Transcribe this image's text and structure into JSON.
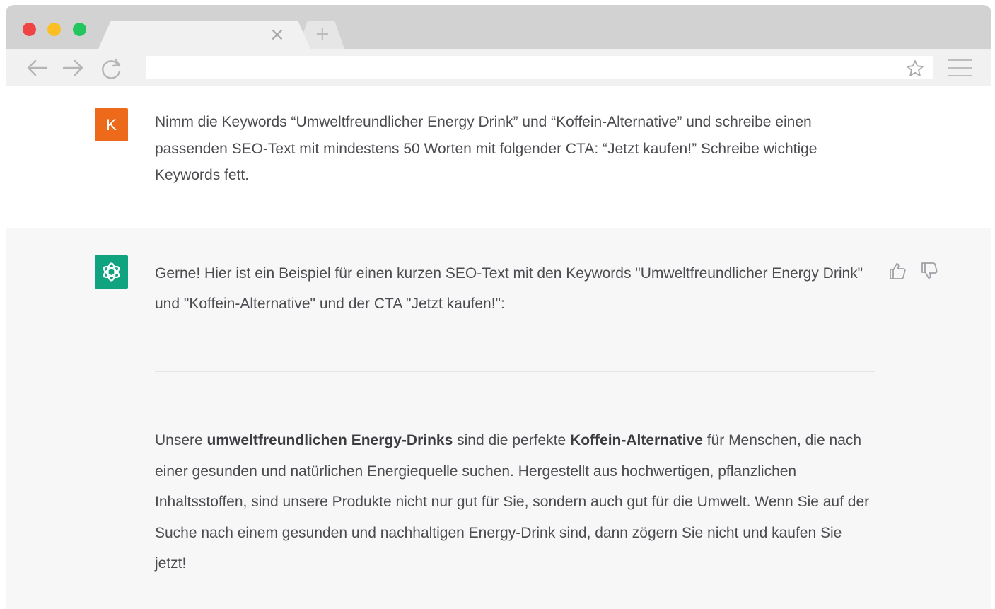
{
  "browser": {
    "tab_close_glyph": "×",
    "new_tab_glyph": "+",
    "address_value": ""
  },
  "colors": {
    "user_avatar_bg": "#ee6a1b",
    "bot_avatar_bg": "#10a37f",
    "traffic_close": "#ef4444",
    "traffic_minimize": "#fbbf24",
    "traffic_maximize": "#22c55e"
  },
  "icons": {
    "back": "arrow-left-icon",
    "forward": "arrow-right-icon",
    "reload": "reload-icon",
    "bookmark": "star-icon",
    "menu": "hamburger-menu-icon",
    "bot_logo": "openai-logo-icon",
    "like": "thumbs-up-icon",
    "dislike": "thumbs-down-icon"
  },
  "user_message": {
    "avatar_letter": "K",
    "text": "Nimm die Keywords “Umweltfreundlicher Energy Drink” und “Koffein-Alternative” und schreibe einen passenden SEO-Text mit mindestens 50 Worten mit folgender CTA: “Jetzt kaufen!” Schreibe wichtige Keywords fett."
  },
  "assistant_message": {
    "intro": "Gerne! Hier ist ein Beispiel für einen kurzen SEO-Text mit den Keywords \"Umweltfreundlicher Energy Drink\" und \"Koffein-Alternative\" und der CTA \"Jetzt kaufen!\":",
    "body": {
      "part1": "Unsere ",
      "bold1": "umweltfreundlichen Energy-Drinks",
      "part2": " sind die perfekte ",
      "bold2": "Koffein-Alternative",
      "part3": " für Menschen, die nach einer gesunden und natürlichen Energiequelle suchen. Hergestellt aus hochwertigen, pflanzlichen Inhaltsstoffen, sind unsere Produkte nicht nur gut für Sie, sondern auch gut für die Umwelt. Wenn Sie auf der Suche nach einem gesunden und nachhaltigen Energy-Drink sind, dann zögern Sie nicht und kaufen Sie jetzt!"
    }
  }
}
